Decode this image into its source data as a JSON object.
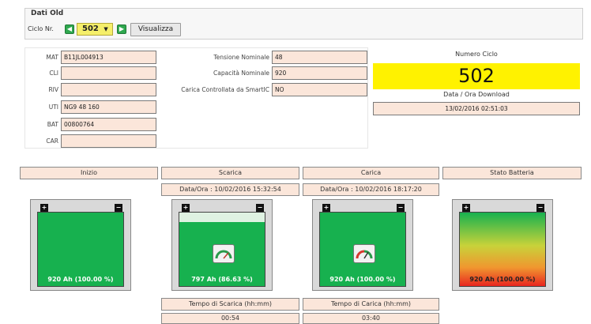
{
  "dati_old": {
    "title": "Dati Old",
    "ciclo_label": "Ciclo Nr.",
    "ciclo_value": "502",
    "visualizza_label": "Visualizza"
  },
  "fields_left": [
    {
      "label": "MAT",
      "value": "B11JL004913"
    },
    {
      "label": "CLI",
      "value": ""
    },
    {
      "label": "RIV",
      "value": ""
    },
    {
      "label": "UTI",
      "value": "NG9 48 160"
    },
    {
      "label": "BAT",
      "value": "00800764"
    },
    {
      "label": "CAR",
      "value": ""
    }
  ],
  "fields_mid": [
    {
      "label": "Tensione Nominale",
      "value": "48"
    },
    {
      "label": "Capacità Nominale",
      "value": "920"
    },
    {
      "label": "Carica Controllata da SmartIC",
      "value": "NO"
    }
  ],
  "numero_ciclo": {
    "label": "Numero Ciclo",
    "value": "502"
  },
  "download": {
    "label": "Data / Ora Download",
    "value": "13/02/2016 02:51:03"
  },
  "columns": {
    "inizio": "Inizio",
    "scarica": "Scarica",
    "carica": "Carica",
    "stato": "Stato Batteria"
  },
  "scarica_date": "Data/Ora : 10/02/2016 15:32:54",
  "carica_date": "Data/Ora : 10/02/2016 18:17:20",
  "batteries": [
    {
      "label": "920 Ah (100.00 %)",
      "fill": 1.0
    },
    {
      "label": "797 Ah (86.63 %)",
      "fill": 0.8663
    },
    {
      "label": "920 Ah (100.00 %)",
      "fill": 1.0
    },
    {
      "label": "920 Ah (100.00 %)",
      "fill": 1.0
    }
  ],
  "tempo_scarica": {
    "label": "Tempo di Scarica (hh:mm)",
    "value": "00:54"
  },
  "tempo_carica": {
    "label": "Tempo di Carica (hh:mm)",
    "value": "03:40"
  },
  "colors": {
    "green": "#17b14f",
    "field_bg": "#fbe6da",
    "yellow": "#fff200"
  }
}
